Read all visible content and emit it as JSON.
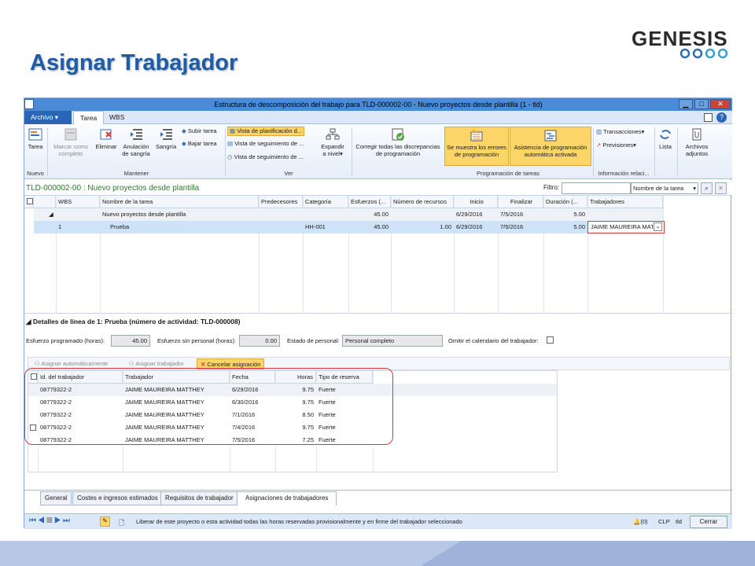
{
  "slide": {
    "title": "Asignar Trabajador",
    "logo": "GENESIS"
  },
  "window": {
    "title": "Estructura de descomposición del trabajo para TLD-000002-00 - Nuevo proyectos desde plantilla (1 - tld)"
  },
  "tabs": {
    "archivo": "Archivo",
    "tarea": "Tarea",
    "wbs": "WBS"
  },
  "ribbon": {
    "tarea": "Tarea",
    "marcar1": "Marcar como",
    "marcar2": "completo",
    "eliminar": "Eliminar",
    "anulacion1": "Anulación",
    "anulacion2": "de sangría",
    "sangria": "Sangría",
    "subir": "Subir tarea",
    "bajar": "Bajar tarea",
    "vista_plan": "Vista de planificación d...",
    "vista_seg1": "Vista de seguimiento de ...",
    "vista_seg2": "Vista de seguimiento de ...",
    "expandir1": "Expandir",
    "expandir2": "a nivel",
    "corregir1": "Corregir todas las discrepancias",
    "corregir2": "de programación",
    "errores1": "Se muestra los errores",
    "errores2": "de programación",
    "asistencia1": "Asistencia de programación",
    "asistencia2": "automática activada",
    "transacciones": "Transacciones",
    "previsiones": "Previsiones",
    "lista": "Lista",
    "archivos1": "Archivos",
    "archivos2": "adjuntos",
    "g_nuevo": "Nuevo",
    "g_mantener": "Mantener",
    "g_ver": "Ver",
    "g_prog": "Programación de tareas",
    "g_info": "Información relaci..."
  },
  "form": {
    "title": "TLD-000002-00 : Nuevo proyectos desde plantilla",
    "filtro": "Filtro:",
    "filter_field": "Nombre de la tarea"
  },
  "grid": {
    "headers": [
      "WBS",
      "Nombre de la tarea",
      "Predecesores",
      "Categoría",
      "Esfuerzos (...",
      "Número de recursos",
      "Inicio",
      "Finalizar",
      "Duración (...",
      "Trabajadores"
    ],
    "rows": [
      {
        "wbs": "",
        "name": "Nuevo proyectos desde plantilla",
        "pred": "",
        "cat": "",
        "esf": "45.00",
        "rec": "",
        "ini": "6/29/2016",
        "fin": "7/5/2016",
        "dur": "5.00",
        "trab": ""
      },
      {
        "wbs": "1",
        "name": "Prueba",
        "pred": "",
        "cat": "HH-001",
        "esf": "45.00",
        "rec": "1.00",
        "ini": "6/29/2016",
        "fin": "7/5/2016",
        "dur": "5.00",
        "trab": "JAIME MAUREIRA MATT"
      }
    ]
  },
  "details": {
    "title": "Detalles de línea de 1: Prueba (número de actividad: TLD-000008)",
    "esf_prog_label": "Esfuerzo programado (horas):",
    "esf_prog": "45.00",
    "esf_sin_label": "Esfuerzo sin personal (horas):",
    "esf_sin": "0.00",
    "estado_label": "Estado de personal:",
    "estado": "Personal completo",
    "omitir_label": "Omitir el calendario del trabajador:",
    "btn_auto": "Asignar automáticamente",
    "btn_asignar": "Asignar trabajador",
    "btn_cancelar": "Cancelar asignación"
  },
  "subgrid": {
    "headers": [
      "Id. del trabajador",
      "Trabajador",
      "Fecha",
      "Horas",
      "Tipo de reserva"
    ],
    "rows": [
      [
        "08779322-2",
        "JAIME MAUREIRA MATTHEY",
        "6/29/2016",
        "9.75",
        "Fuerte"
      ],
      [
        "08779322-2",
        "JAIME MAUREIRA MATTHEY",
        "6/30/2016",
        "9.75",
        "Fuerte"
      ],
      [
        "08779322-2",
        "JAIME MAUREIRA MATTHEY",
        "7/1/2016",
        "8.50",
        "Fuerte"
      ],
      [
        "08779322-2",
        "JAIME MAUREIRA MATTHEY",
        "7/4/2016",
        "9.75",
        "Fuerte"
      ],
      [
        "08779322-2",
        "JAIME MAUREIRA MATTHEY",
        "7/5/2016",
        "7.25",
        "Fuerte"
      ]
    ]
  },
  "bottom_tabs": [
    "General",
    "Costes e ingresos estimados",
    "Requisitos de trabajador",
    "Asignaciones de trabajadores"
  ],
  "status": {
    "message": "Liberar de este proyecto o esta actividad todas las horas reservadas provisionalmente y en firme del trabajador seleccionado",
    "alerts": "(0)",
    "company": "CLP",
    "user": "tld",
    "close": "Cerrar"
  }
}
